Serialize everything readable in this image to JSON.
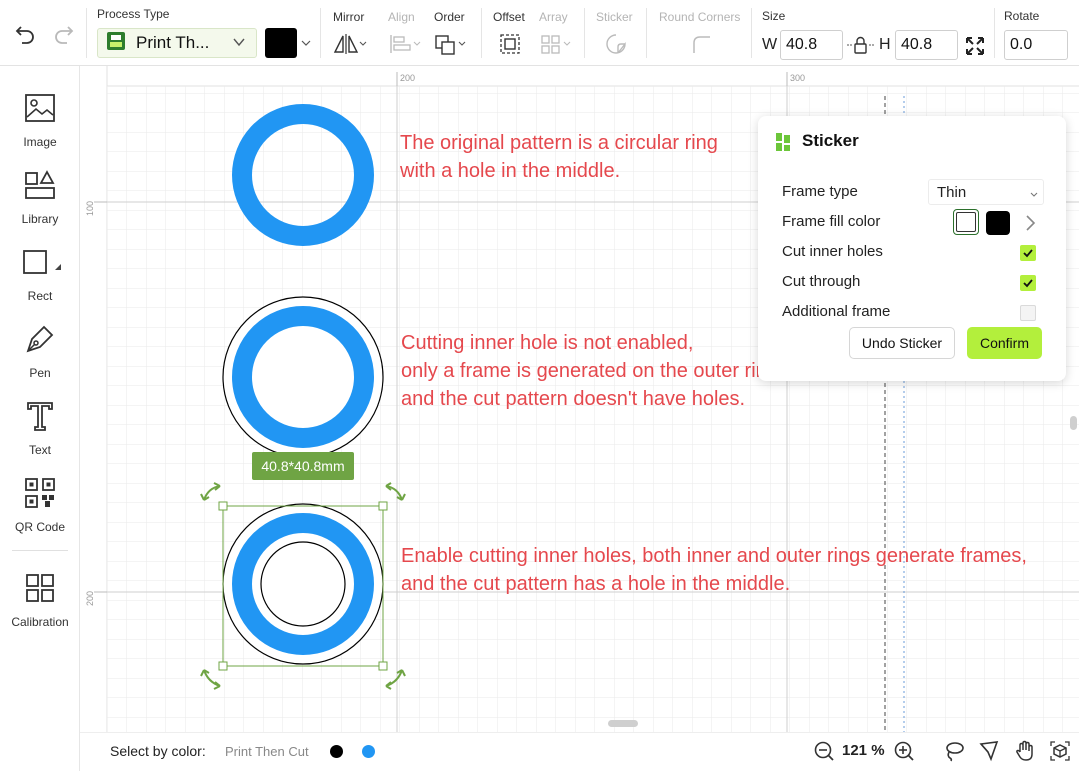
{
  "toolbar": {
    "undo_icon": "undo-icon",
    "redo_icon": "redo-icon",
    "process_type_label": "Process Type",
    "process_type_value": "Print Th...",
    "color_value": "#000000",
    "mirror_label": "Mirror",
    "align_label": "Align",
    "order_label": "Order",
    "offset_label": "Offset",
    "array_label": "Array",
    "sticker_label": "Sticker",
    "round_corners_label": "Round Corners",
    "size_label": "Size",
    "width_label": "W",
    "width_value": "40.8",
    "height_label": "H",
    "height_value": "40.8",
    "rotate_label": "Rotate",
    "rotate_value": "0.0"
  },
  "sidebar": {
    "items": [
      {
        "label": "Image",
        "icon": "image-icon"
      },
      {
        "label": "Library",
        "icon": "library-icon"
      },
      {
        "label": "Rect",
        "icon": "rect-icon"
      },
      {
        "label": "Pen",
        "icon": "pen-icon"
      },
      {
        "label": "Text",
        "icon": "text-icon"
      },
      {
        "label": "QR Code",
        "icon": "qr-code-icon"
      },
      {
        "label": "Calibration",
        "icon": "calibration-icon"
      }
    ]
  },
  "canvas": {
    "ruler_top": [
      "200",
      "300"
    ],
    "ruler_left": [
      "100",
      "200"
    ],
    "ring_color": "#2196f3",
    "annotations": [
      {
        "lines": [
          "The original pattern is a circular ring",
          "with a hole in the middle."
        ]
      },
      {
        "lines": [
          "Cutting inner hole is not enabled,",
          "only a frame is generated on the outer ring,",
          "and the cut pattern doesn't have holes."
        ]
      },
      {
        "lines": [
          "Enable cutting inner holes, both inner and outer rings generate frames,",
          "and the cut pattern has a hole in the middle."
        ]
      }
    ],
    "dimension_tag": "40.8*40.8mm"
  },
  "sticker_panel": {
    "title": "Sticker",
    "frame_type_label": "Frame type",
    "frame_type_value": "Thin",
    "frame_fill_label": "Frame fill color",
    "cut_inner_holes_label": "Cut inner holes",
    "cut_inner_holes": true,
    "cut_through_label": "Cut through",
    "cut_through": true,
    "additional_frame_label": "Additional frame",
    "additional_frame": false,
    "undo_button": "Undo Sticker",
    "confirm_button": "Confirm",
    "accent_color": "#b3ef3c"
  },
  "statusbar": {
    "select_by_color_label": "Select by color:",
    "process_hint": "Print Then Cut",
    "colors": [
      "#000000",
      "#2196f3"
    ],
    "zoom": "121 %"
  }
}
